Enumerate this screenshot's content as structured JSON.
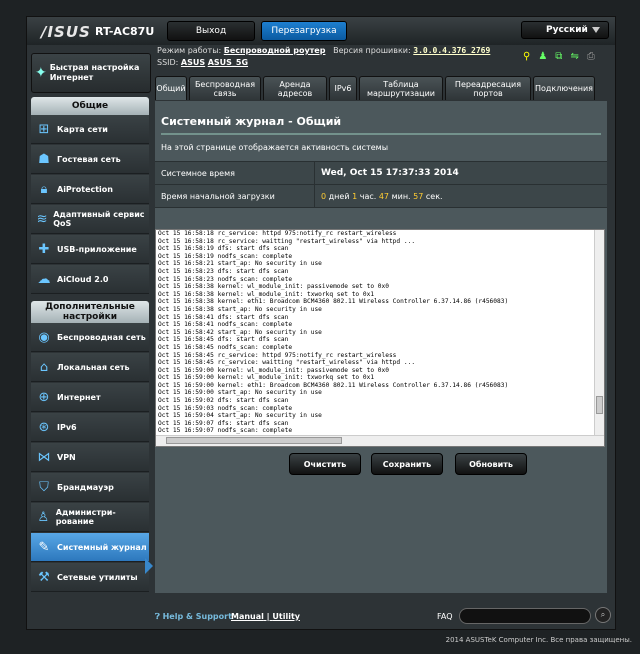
{
  "header": {
    "logo": "/ISUS",
    "model": "RT-AC87U",
    "logout": "Выход",
    "reboot": "Перезагрузка",
    "language": "Русский",
    "mode_label": "Режим работы:",
    "mode_value": "Беспроводной роутер",
    "fw_label": "Версия прошивки:",
    "fw_value": "3.0.0.4.376_2769",
    "ssid_label": "SSID:",
    "ssid1": "ASUS",
    "ssid2": "ASUS_5G"
  },
  "sidebar": {
    "quick": "Быстрая настройка Интернет",
    "general_head": "Общие",
    "general": [
      {
        "label": "Карта сети",
        "icon": "network-map-icon"
      },
      {
        "label": "Гостевая сеть",
        "icon": "guest-network-icon"
      },
      {
        "label": "AiProtection",
        "icon": "lock-icon"
      },
      {
        "label": "Адаптивный сервис QoS",
        "icon": "qos-icon"
      },
      {
        "label": "USB-приложение",
        "icon": "puzzle-icon"
      },
      {
        "label": "AiCloud 2.0",
        "icon": "cloud-icon"
      }
    ],
    "advanced_head": "Дополнительные настройки",
    "advanced": [
      {
        "label": "Беспроводная сеть",
        "icon": "wifi-icon"
      },
      {
        "label": "Локальная сеть",
        "icon": "home-icon"
      },
      {
        "label": "Интернет",
        "icon": "globe-icon"
      },
      {
        "label": "IPv6",
        "icon": "ipv6-globe-icon"
      },
      {
        "label": "VPN",
        "icon": "vpn-icon"
      },
      {
        "label": "Брандмауэр",
        "icon": "shield-icon"
      },
      {
        "label": "Администри-рование",
        "icon": "admin-user-icon"
      },
      {
        "label": "Системный журнал",
        "icon": "system-log-icon"
      },
      {
        "label": "Сетевые утилиты",
        "icon": "tools-icon"
      }
    ]
  },
  "tabs": [
    "Общий",
    "Беспроводная связь",
    "Аренда адресов",
    "IPv6",
    "Таблица маршрутизации",
    "Переадресация портов",
    "Подключения"
  ],
  "panel": {
    "title": "Системный журнал - Общий",
    "desc": "На этой странице отображается активность системы",
    "time_label": "Системное время",
    "time_value": "Wed, Oct 15 17:37:33 2014",
    "uptime_label": "Время начальной загрузки",
    "uptime_days": "0",
    "uptime_days_unit": "дней",
    "uptime_hours": "1",
    "uptime_hours_unit": "час.",
    "uptime_min": "47",
    "uptime_min_unit": "мин.",
    "uptime_sec": "57",
    "uptime_sec_unit": "сек."
  },
  "log": [
    "Oct 15 16:58:18 rc_service: httpd 975:notify_rc restart_wireless",
    "Oct 15 16:58:18 rc_service: waitting \"restart_wireless\" via httpd ...",
    "Oct 15 16:58:19 dfs: start dfs scan",
    "Oct 15 16:58:19 nodfs_scan: complete",
    "Oct 15 16:58:21 start_ap: No security in use",
    "Oct 15 16:58:23 dfs: start dfs scan",
    "Oct 15 16:58:23 nodfs_scan: complete",
    "Oct 15 16:58:38 kernel: wl_module_init: passivemode set to 0x0",
    "Oct 15 16:58:38 kernel: wl_module_init: txworkq set to 0x1",
    "Oct 15 16:58:38 kernel: eth1: Broadcom BCM4360 802.11 Wireless Controller 6.37.14.86 (r456083)",
    "Oct 15 16:58:38 start_ap: No security in use",
    "Oct 15 16:58:41 dfs: start dfs scan",
    "Oct 15 16:58:41 nodfs_scan: complete",
    "Oct 15 16:58:42 start_ap: No security in use",
    "Oct 15 16:58:45 dfs: start dfs scan",
    "Oct 15 16:58:45 nodfs_scan: complete",
    "Oct 15 16:58:45 rc_service: httpd 975:notify_rc restart_wireless",
    "Oct 15 16:58:45 rc_service: waitting \"restart_wireless\" via httpd ...",
    "Oct 15 16:59:00 kernel: wl_module_init: passivemode set to 0x0",
    "Oct 15 16:59:00 kernel: wl_module_init: txworkq set to 0x1",
    "Oct 15 16:59:00 kernel: eth1: Broadcom BCM4360 802.11 Wireless Controller 6.37.14.86 (r456083)",
    "Oct 15 16:59:00 start_ap: No security in use",
    "Oct 15 16:59:02 dfs: start dfs scan",
    "Oct 15 16:59:03 nodfs_scan: complete",
    "Oct 15 16:59:04 start_ap: No security in use",
    "Oct 15 16:59:07 dfs: start dfs scan",
    "Oct 15 16:59:07 nodfs_scan: complete"
  ],
  "buttons": {
    "clear": "Очистить",
    "save": "Сохранить",
    "refresh": "Обновить"
  },
  "footer": {
    "help": "Help & Support",
    "manual": "Manual",
    "utility": "Utility",
    "faq": "FAQ",
    "copyright": "2014  ASUSTeK Computer Inc. Все права защищены."
  }
}
